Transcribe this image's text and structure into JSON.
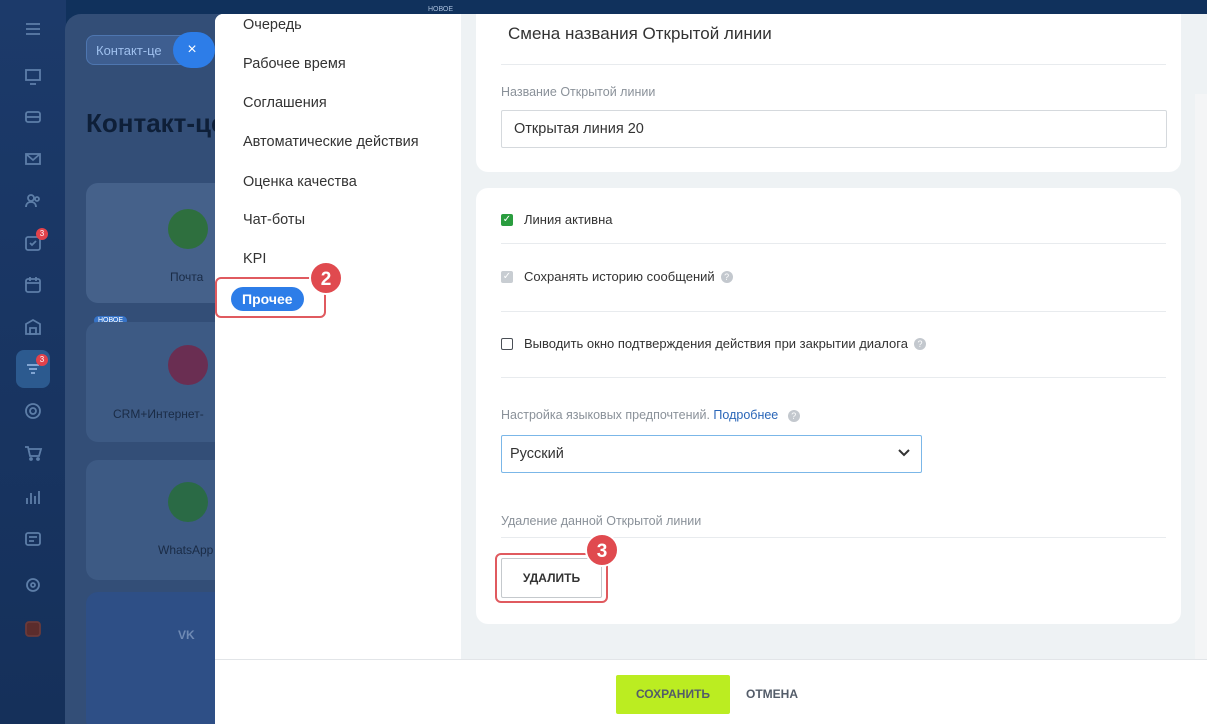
{
  "background": {
    "new_badge_top": "НОВОЕ",
    "breadcrumb": "Контакт-це",
    "close_glyph": "×",
    "page_title": "Контакт-це",
    "new_badge": "НОВОЕ",
    "cards": [
      "Почта",
      "CRM+Интернет-",
      "WhatsApp",
      "VK"
    ],
    "rail_badges": [
      "3",
      "3"
    ]
  },
  "menu": {
    "items": [
      "Очередь",
      "Рабочее время",
      "Соглашения",
      "Автоматические действия",
      "Оценка качества",
      "Чат-боты",
      "KPI"
    ],
    "active": "Прочее"
  },
  "steps": {
    "step2": "2",
    "step3": "3"
  },
  "rename_card": {
    "title": "Смена названия Открытой линии",
    "name_label": "Название Открытой линии",
    "name_value": "Открытая линия 20"
  },
  "settings_card": {
    "line_active": "Линия активна",
    "save_history": "Сохранять историю сообщений",
    "confirm_window": "Выводить окно подтверждения действия при закрытии диалога",
    "lang_label": "Настройка языковых предпочтений.",
    "lang_link": "Подробнее",
    "lang_value": "Русский",
    "delete_label": "Удаление данной Открытой линии",
    "delete_button": "УДАЛИТЬ",
    "help_glyph": "?",
    "check_glyph": "✓"
  },
  "footer": {
    "save": "СОХРАНИТЬ",
    "cancel": "ОТМЕНА"
  },
  "colors": {
    "accent": "#2d7de8",
    "save": "#bbed21",
    "highlight": "#e05a5f",
    "checkbox_on": "#2a9d3f"
  }
}
